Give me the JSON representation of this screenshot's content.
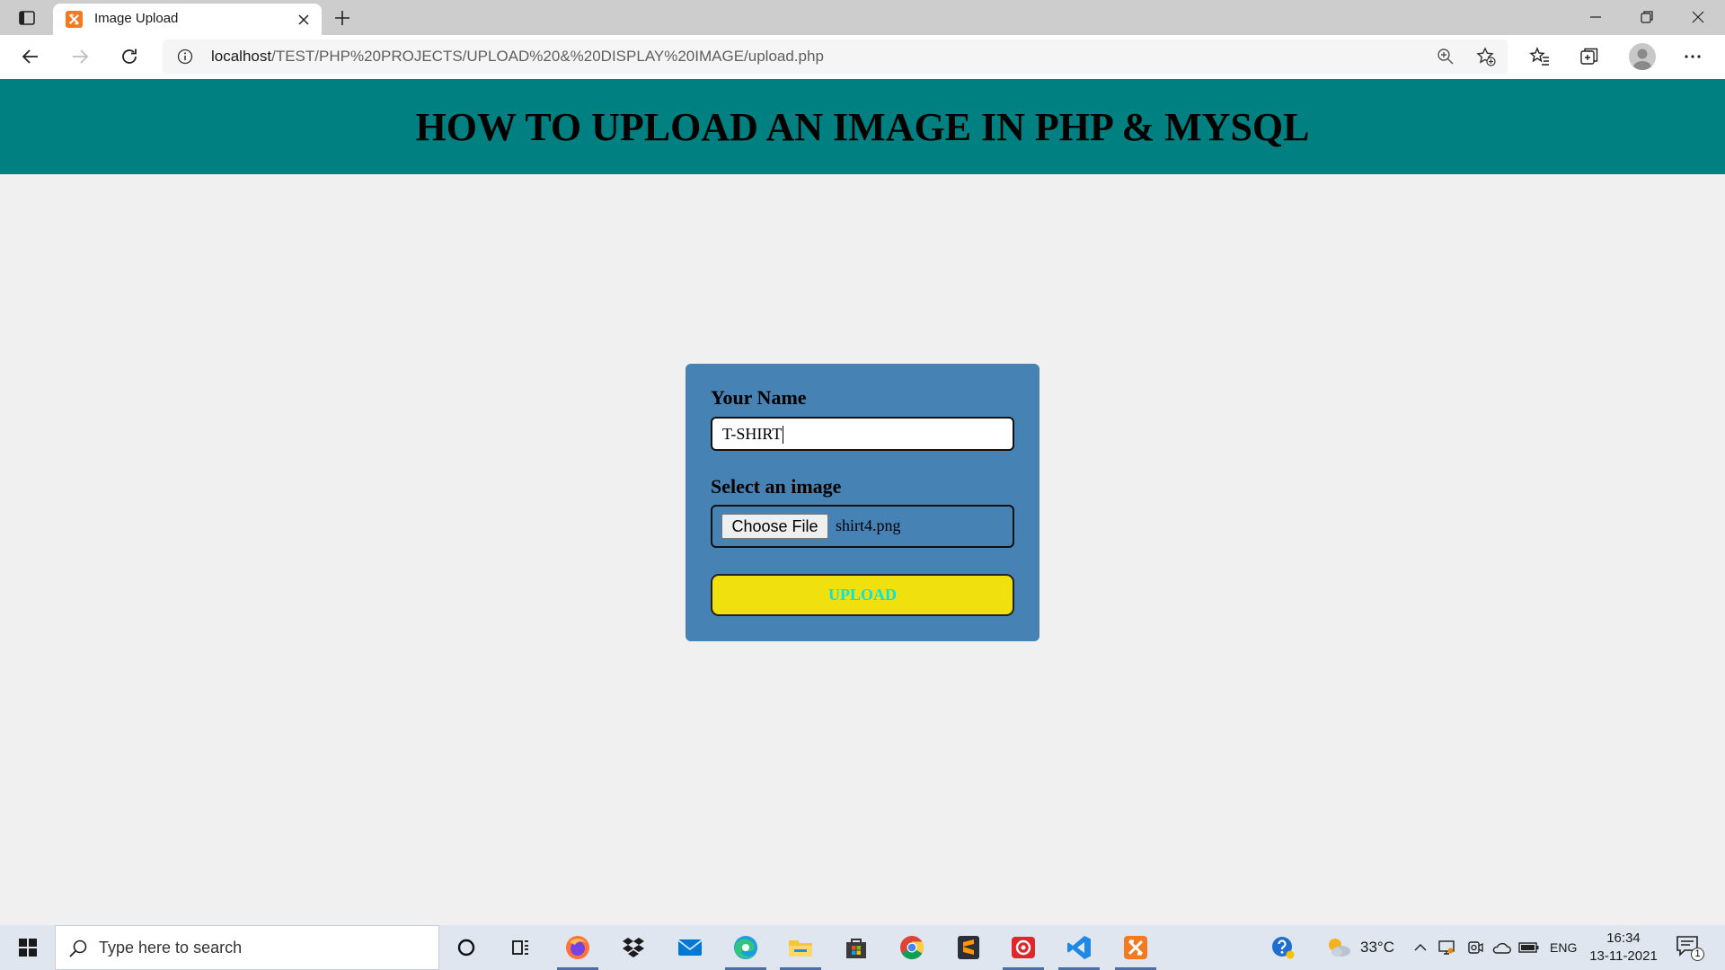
{
  "browser": {
    "tab_title": "Image Upload",
    "tab_icon": "xampp-icon",
    "url_host": "localhost",
    "url_path": "/TEST/PHP%20PROJECTS/UPLOAD%20&%20DISPLAY%20IMAGE/upload.php"
  },
  "page": {
    "heading": "HOW TO UPLOAD AN IMAGE IN PHP & MYSQL",
    "form": {
      "name_label": "Your Name",
      "name_value": "T-SHIRT",
      "image_label": "Select an image",
      "choose_file_label": "Choose File",
      "selected_file": "shirt4.png",
      "upload_label": "UPLOAD"
    }
  },
  "taskbar": {
    "search_placeholder": "Type here to search",
    "apps": [
      {
        "icon": "cortana-icon",
        "running": false
      },
      {
        "icon": "task-view-icon",
        "running": false
      },
      {
        "icon": "firefox-icon",
        "running": true
      },
      {
        "icon": "dropbox-icon",
        "running": false
      },
      {
        "icon": "mail-icon",
        "running": false
      },
      {
        "icon": "edge-icon",
        "running": true
      },
      {
        "icon": "file-explorer-icon",
        "running": true
      },
      {
        "icon": "microsoft-store-icon",
        "running": false
      },
      {
        "icon": "chrome-icon",
        "running": false
      },
      {
        "icon": "sublime-text-icon",
        "running": false
      },
      {
        "icon": "recorder-icon",
        "running": true
      },
      {
        "icon": "vscode-icon",
        "running": true
      },
      {
        "icon": "xampp-icon",
        "running": true
      }
    ],
    "temperature": "33°C",
    "language": "ENG",
    "time": "16:34",
    "date": "13-11-2021",
    "notification_count": "1"
  },
  "colors": {
    "header_bg": "#008080",
    "page_bg": "#f0f0f0",
    "form_bg": "#4682b4",
    "upload_bg": "#f0e00e",
    "upload_text": "#00e5e5"
  }
}
